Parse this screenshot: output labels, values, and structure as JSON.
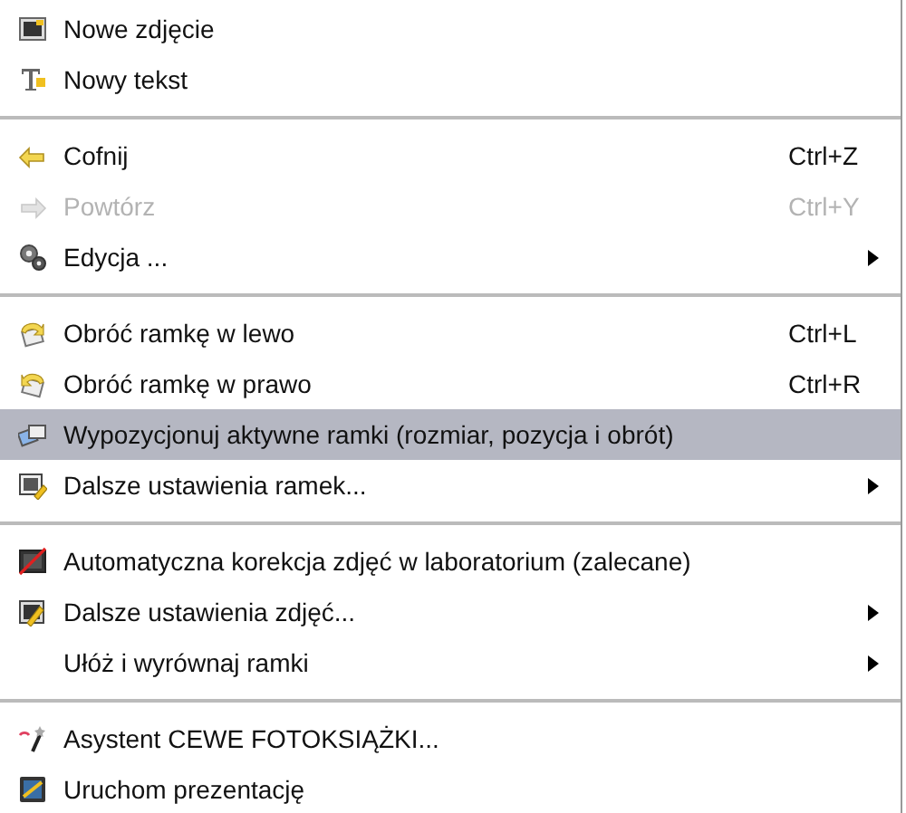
{
  "menu": {
    "entries": [
      {
        "kind": "item",
        "label": "Nowe zdjęcie",
        "disabled": false,
        "selected": false
      },
      {
        "kind": "item",
        "label": "Nowy tekst",
        "disabled": false,
        "selected": false
      },
      {
        "kind": "separator"
      },
      {
        "kind": "item",
        "label": "Cofnij",
        "shortcut": "Ctrl+Z",
        "disabled": false,
        "selected": false
      },
      {
        "kind": "item",
        "label": "Powtórz",
        "shortcut": "Ctrl+Y",
        "disabled": true,
        "selected": false
      },
      {
        "kind": "item",
        "label": "Edycja ...",
        "submenu": true,
        "disabled": false,
        "selected": false
      },
      {
        "kind": "separator"
      },
      {
        "kind": "item",
        "label": "Obróć ramkę w lewo",
        "shortcut": "Ctrl+L",
        "disabled": false,
        "selected": false
      },
      {
        "kind": "item",
        "label": "Obróć ramkę w prawo",
        "shortcut": "Ctrl+R",
        "disabled": false,
        "selected": false
      },
      {
        "kind": "item",
        "label": "Wypozycjonuj aktywne ramki (rozmiar, pozycja i obrót)",
        "disabled": false,
        "selected": true
      },
      {
        "kind": "item",
        "label": "Dalsze ustawienia ramek...",
        "submenu": true,
        "disabled": false,
        "selected": false
      },
      {
        "kind": "separator"
      },
      {
        "kind": "item",
        "label": "Automatyczna korekcja zdjęć w laboratorium (zalecane)",
        "disabled": false,
        "selected": false
      },
      {
        "kind": "item",
        "label": "Dalsze ustawienia zdjęć...",
        "submenu": true,
        "disabled": false,
        "selected": false
      },
      {
        "kind": "item",
        "label": "Ułóż i wyrównaj ramki",
        "submenu": true,
        "disabled": false,
        "selected": false
      },
      {
        "kind": "separator"
      },
      {
        "kind": "item",
        "label": "Asystent CEWE FOTOKSIĄŻKI...",
        "disabled": false,
        "selected": false
      },
      {
        "kind": "item",
        "label": "Uruchom prezentację",
        "disabled": false,
        "selected": false
      }
    ]
  }
}
